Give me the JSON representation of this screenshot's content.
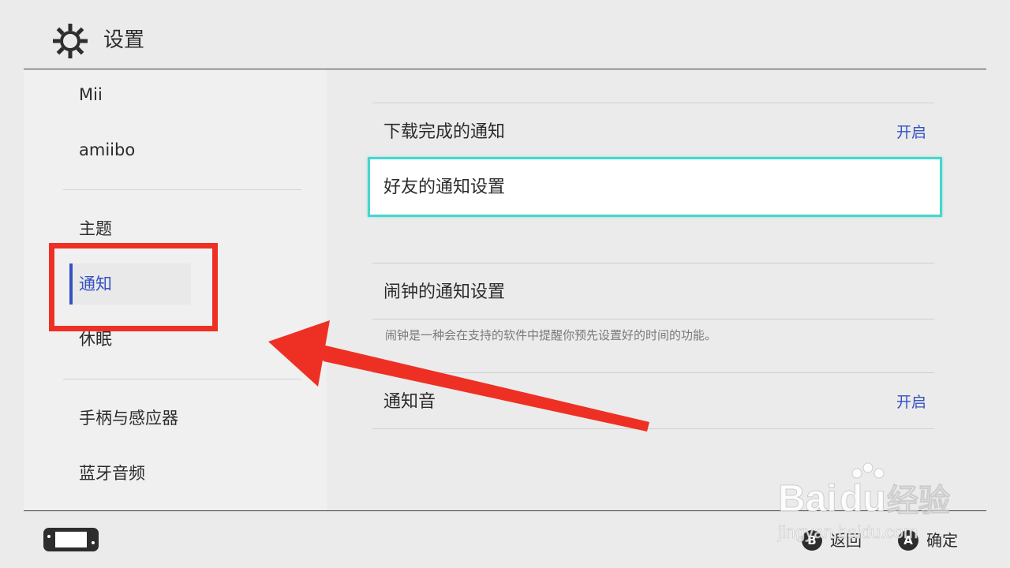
{
  "header": {
    "title": "设置",
    "icon": "gear-icon"
  },
  "sidebar": {
    "items": [
      {
        "label": "Mii"
      },
      {
        "label": "amiibo"
      },
      {
        "label": "主题"
      },
      {
        "label": "通知",
        "active": true
      },
      {
        "label": "休眠"
      },
      {
        "label": "手柄与感应器"
      },
      {
        "label": "蓝牙音频"
      }
    ]
  },
  "content": {
    "rows": [
      {
        "label": "下载完成的通知",
        "value": "开启"
      },
      {
        "label": "好友的通知设置",
        "focused": true
      },
      {
        "label": "闹钟的通知设置",
        "description": "闹钟是一种会在支持的软件中提醒你预先设置好的时间的功能。"
      },
      {
        "label": "通知音",
        "value": "开启"
      }
    ]
  },
  "footer": {
    "back": {
      "button": "B",
      "label": "返回"
    },
    "confirm": {
      "button": "A",
      "label": "确定"
    }
  },
  "watermark": {
    "brand": "Bai",
    "brand2": "du",
    "brand_cn": "经验",
    "url": "jingyan.baidu.com"
  },
  "colors": {
    "accent": "#3551c3",
    "focus": "#47d6cf",
    "annotation": "#ee3024",
    "background": "#ebebeb"
  }
}
